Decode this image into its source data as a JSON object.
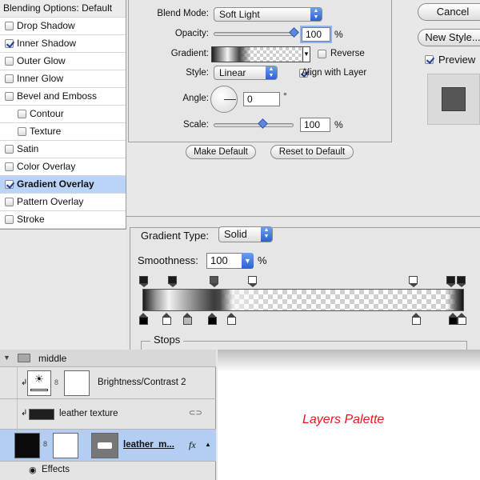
{
  "styles_panel": {
    "header": "Blending Options: Default",
    "items": [
      {
        "label": "Drop Shadow",
        "checked": false,
        "indent": false,
        "selected": false
      },
      {
        "label": "Inner Shadow",
        "checked": true,
        "indent": false,
        "selected": false
      },
      {
        "label": "Outer Glow",
        "checked": false,
        "indent": false,
        "selected": false
      },
      {
        "label": "Inner Glow",
        "checked": false,
        "indent": false,
        "selected": false
      },
      {
        "label": "Bevel and Emboss",
        "checked": false,
        "indent": false,
        "selected": false
      },
      {
        "label": "Contour",
        "checked": false,
        "indent": true,
        "selected": false
      },
      {
        "label": "Texture",
        "checked": false,
        "indent": true,
        "selected": false
      },
      {
        "label": "Satin",
        "checked": false,
        "indent": false,
        "selected": false
      },
      {
        "label": "Color Overlay",
        "checked": false,
        "indent": false,
        "selected": false
      },
      {
        "label": "Gradient Overlay",
        "checked": true,
        "indent": false,
        "selected": true
      },
      {
        "label": "Pattern Overlay",
        "checked": false,
        "indent": false,
        "selected": false
      },
      {
        "label": "Stroke",
        "checked": false,
        "indent": false,
        "selected": false
      }
    ]
  },
  "gradient_overlay": {
    "blend_mode_label": "Blend Mode:",
    "blend_mode_value": "Soft Light",
    "opacity_label": "Opacity:",
    "opacity_value": "100",
    "opacity_unit": "%",
    "gradient_label": "Gradient:",
    "reverse_label": "Reverse",
    "reverse_checked": false,
    "style_label": "Style:",
    "style_value": "Linear",
    "align_label": "Align with Layer",
    "align_checked": true,
    "angle_label": "Angle:",
    "angle_value": "0",
    "angle_unit": "°",
    "scale_label": "Scale:",
    "scale_value": "100",
    "scale_unit": "%",
    "make_default": "Make Default",
    "reset_default": "Reset to Default"
  },
  "dialog_buttons": {
    "cancel": "Cancel",
    "new_style": "New Style...",
    "preview_label": "Preview",
    "preview_checked": true
  },
  "gradient_editor": {
    "type_label": "Gradient Type:",
    "type_value": "Solid",
    "smoothness_label": "Smoothness:",
    "smoothness_value": "100",
    "smoothness_unit": "%",
    "stops_label": "Stops"
  },
  "layers": {
    "group_name": "middle",
    "rows": [
      {
        "name": "Brightness/Contrast 2"
      },
      {
        "name": "leather texture"
      },
      {
        "name": "leather_m...",
        "fx": "fx"
      }
    ],
    "effects_label": "Effects"
  },
  "caption": "Layers Palette",
  "colors": {
    "selection": "#b9d4f8",
    "caption_red": "#e8161c",
    "accent_blue": "#2a61d2"
  }
}
